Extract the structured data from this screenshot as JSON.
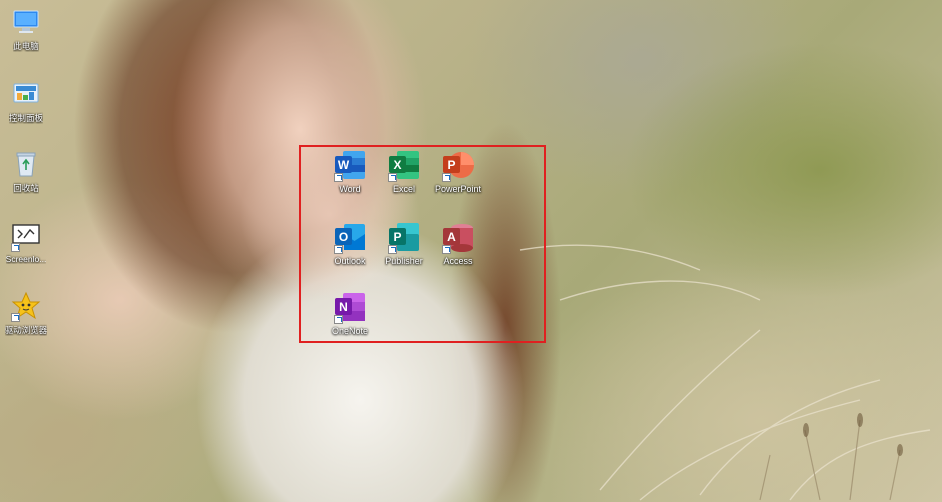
{
  "desktop": {
    "left_icons": [
      {
        "label": "此电脑",
        "icon": "this-pc-icon"
      },
      {
        "label": "控制面板",
        "icon": "control-panel-icon"
      },
      {
        "label": "回收站",
        "icon": "recycle-bin-icon"
      },
      {
        "label": "Screenlo...",
        "icon": "screen-recorder-icon"
      },
      {
        "label": "驱动浏览器",
        "icon": "star-browser-icon"
      }
    ],
    "office_apps": [
      {
        "label": "Word",
        "letter": "W",
        "color": "#185abd",
        "icon": "word-icon"
      },
      {
        "label": "Excel",
        "letter": "X",
        "color": "#107c41",
        "icon": "excel-icon"
      },
      {
        "label": "PowerPoint",
        "letter": "P",
        "color": "#c43e1c",
        "icon": "powerpoint-icon"
      },
      {
        "label": "Outlook",
        "letter": "O",
        "color": "#0a64b8",
        "icon": "outlook-icon"
      },
      {
        "label": "Publisher",
        "letter": "P",
        "color": "#077568",
        "icon": "publisher-icon"
      },
      {
        "label": "Access",
        "letter": "A",
        "color": "#a4373a",
        "icon": "access-icon"
      },
      {
        "label": "OneNote",
        "letter": "N",
        "color": "#7719aa",
        "icon": "onenote-icon"
      }
    ],
    "highlight_color": "#e02020"
  }
}
